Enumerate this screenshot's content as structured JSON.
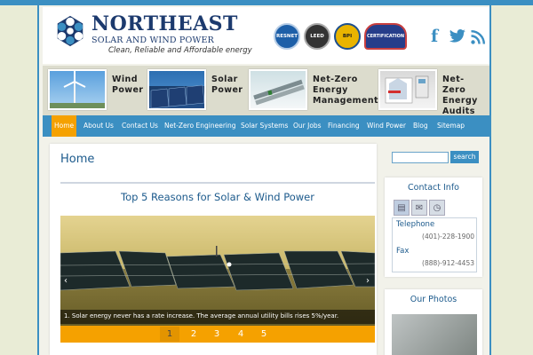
{
  "brand": {
    "name": "NORTHEAST",
    "subtitle": "SOLAR AND WIND POWER",
    "tagline": "Clean, Reliable and Affordable energy"
  },
  "badges": [
    {
      "label": "RESNET"
    },
    {
      "label": "LEED"
    },
    {
      "label": "BPI"
    },
    {
      "label": "CERTIFICATION"
    }
  ],
  "social": {
    "facebook": "f",
    "twitter": "t",
    "rss": "rss-icon"
  },
  "features": [
    {
      "line1": "Wind",
      "line2": "Power",
      "line3": "",
      "line4": ""
    },
    {
      "line1": "Solar",
      "line2": "Power",
      "line3": "",
      "line4": ""
    },
    {
      "line1": "Net-Zero",
      "line2": "Energy",
      "line3": "Management",
      "line4": ""
    },
    {
      "line1": "Net-Zero",
      "line2": "Energy",
      "line3": "Audits",
      "line4": ""
    }
  ],
  "nav": [
    {
      "label": "Home"
    },
    {
      "label": "About Us"
    },
    {
      "label": "Contact Us"
    },
    {
      "label": "Net-Zero Engineering"
    },
    {
      "label": "Solar Systems"
    },
    {
      "label": "Our Jobs"
    },
    {
      "label": "Financing"
    },
    {
      "label": "Wind Power"
    },
    {
      "label": "Blog"
    },
    {
      "label": "Sitemap"
    }
  ],
  "page": {
    "title": "Home",
    "post_title": "Top 5 Reasons for Solar & Wind Power",
    "caption": "1. Solar energy never has a rate increase. The average annual utility bills rises 5%/year.",
    "pager": [
      "1",
      "2",
      "3",
      "4",
      "5"
    ],
    "prev": "‹",
    "next": "›"
  },
  "search": {
    "button": "search",
    "value": ""
  },
  "contact": {
    "title": "Contact Info",
    "telephone_label": "Telephone",
    "telephone": "(401)-228-1900",
    "fax_label": "Fax",
    "fax": "(888)-912-4453"
  },
  "photos": {
    "title": "Our Photos"
  },
  "colors": {
    "accent": "#3b8fc2",
    "active": "#f5a100",
    "heading": "#1c5a8c"
  }
}
